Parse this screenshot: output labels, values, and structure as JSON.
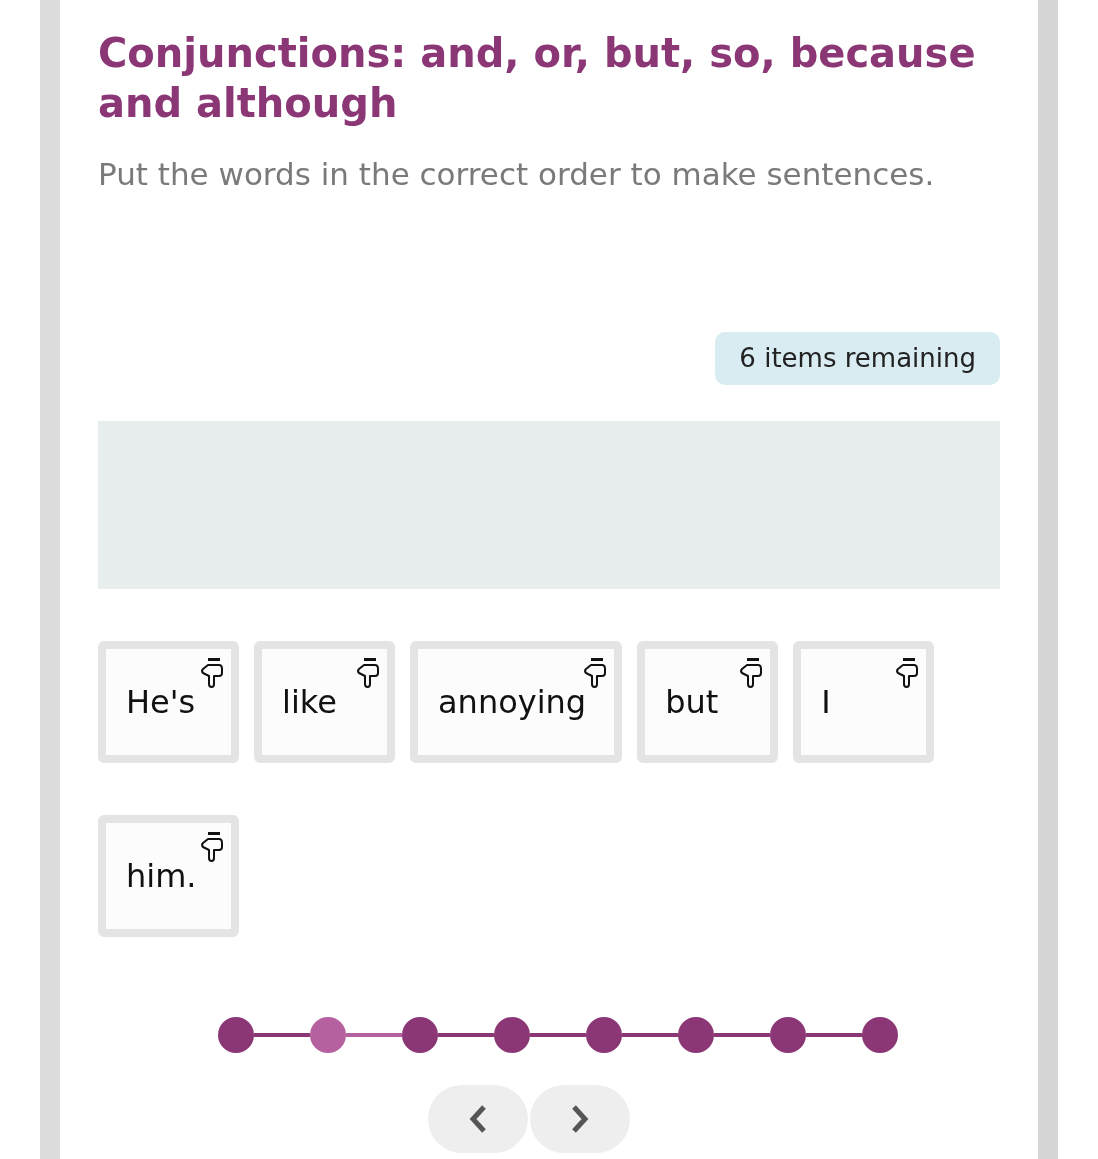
{
  "title": "Conjunctions: and, or, but, so, because and although",
  "instruction": "Put the words in the correct order to make sentences.",
  "remaining": "6 items remaining",
  "words": [
    "He's",
    "like",
    "annoying",
    "but",
    "I",
    "him."
  ],
  "steps": [
    {
      "selected": false
    },
    {
      "selected": true
    },
    {
      "selected": false
    },
    {
      "selected": false
    },
    {
      "selected": false
    },
    {
      "selected": false
    },
    {
      "selected": false
    },
    {
      "selected": false
    }
  ]
}
